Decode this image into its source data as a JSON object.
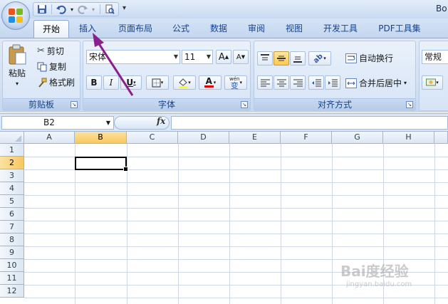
{
  "window": {
    "title": "Bo"
  },
  "quick_access": {
    "items": [
      "save-icon",
      "undo-icon",
      "redo-icon",
      "print-preview-icon"
    ],
    "more": "▾"
  },
  "tabs": [
    {
      "label": "开始",
      "active": true
    },
    {
      "label": "插入",
      "active": false
    },
    {
      "label": "页面布局",
      "active": false
    },
    {
      "label": "公式",
      "active": false
    },
    {
      "label": "数据",
      "active": false
    },
    {
      "label": "审阅",
      "active": false
    },
    {
      "label": "视图",
      "active": false
    },
    {
      "label": "开发工具",
      "active": false
    },
    {
      "label": "PDF工具集",
      "active": false
    }
  ],
  "ribbon": {
    "clipboard": {
      "label": "剪贴板",
      "paste": "粘贴",
      "cut": "剪切",
      "copy": "复制",
      "format_painter": "格式刷"
    },
    "font": {
      "label": "字体",
      "font_name": "宋体",
      "font_size": "11",
      "grow": "A",
      "shrink": "A",
      "bold": "B",
      "italic": "I",
      "underline": "U",
      "font_color_glyph": "A",
      "phonetic_glyph": "wén",
      "phonetic_glyph2": "变"
    },
    "alignment": {
      "label": "对齐方式",
      "wrap_text": "自动换行",
      "merge_center": "合并后居中"
    },
    "number": {
      "format": "常规"
    }
  },
  "formula_bar": {
    "name_box": "B2",
    "fx": "fx",
    "formula": ""
  },
  "grid": {
    "columns": [
      "A",
      "B",
      "C",
      "D",
      "E",
      "F",
      "G",
      "H"
    ],
    "selected_column": "B",
    "rows": [
      "1",
      "2",
      "3",
      "4",
      "5",
      "6",
      "7",
      "8",
      "9",
      "10",
      "11",
      "12"
    ],
    "selected_row": "2",
    "active_cell": "B2"
  },
  "watermark": {
    "main": "Bai度经验",
    "sub": "jingyan.baidu.com"
  },
  "colors": {
    "tab_text": "#15428b",
    "selection_header": "#f8c860",
    "arrow": "#8b1f8f"
  }
}
